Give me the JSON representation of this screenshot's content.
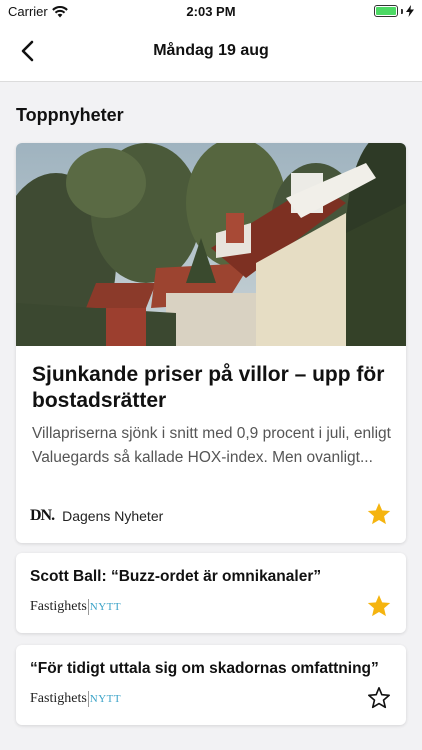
{
  "status_bar": {
    "carrier": "Carrier",
    "time": "2:03 PM",
    "battery_level": 1.0,
    "battery_color": "#4cd964"
  },
  "nav": {
    "back_icon": "chevron-left-icon",
    "title": "Måndag 19 aug"
  },
  "section": {
    "title": "Toppnyheter"
  },
  "articles": [
    {
      "headline": "Sjunkande priser på villor – upp för bostadsrätter",
      "excerpt": "Villapriserna sjönk i snitt med 0,9 procent i juli, enligt Valuegards så kallade HOX-index. Men ovanligt...",
      "source_logo_text": "DN.",
      "source_name": "Dagens Nyheter",
      "starred": true,
      "image": "houses-roofs-photo"
    },
    {
      "headline": "Scott Ball: “Buzz-ordet är omnikanaler”",
      "source_logo": [
        "Fastighets",
        "NYTT"
      ],
      "starred": true
    },
    {
      "headline": "“För tidigt uttala sig om skadornas omfattning”",
      "source_logo": [
        "Fastighets",
        "NYTT"
      ],
      "starred": false
    }
  ],
  "colors": {
    "star_filled": "#f5b40f",
    "nytt_accent": "#3ba3c8",
    "background": "#f2f2f4"
  }
}
